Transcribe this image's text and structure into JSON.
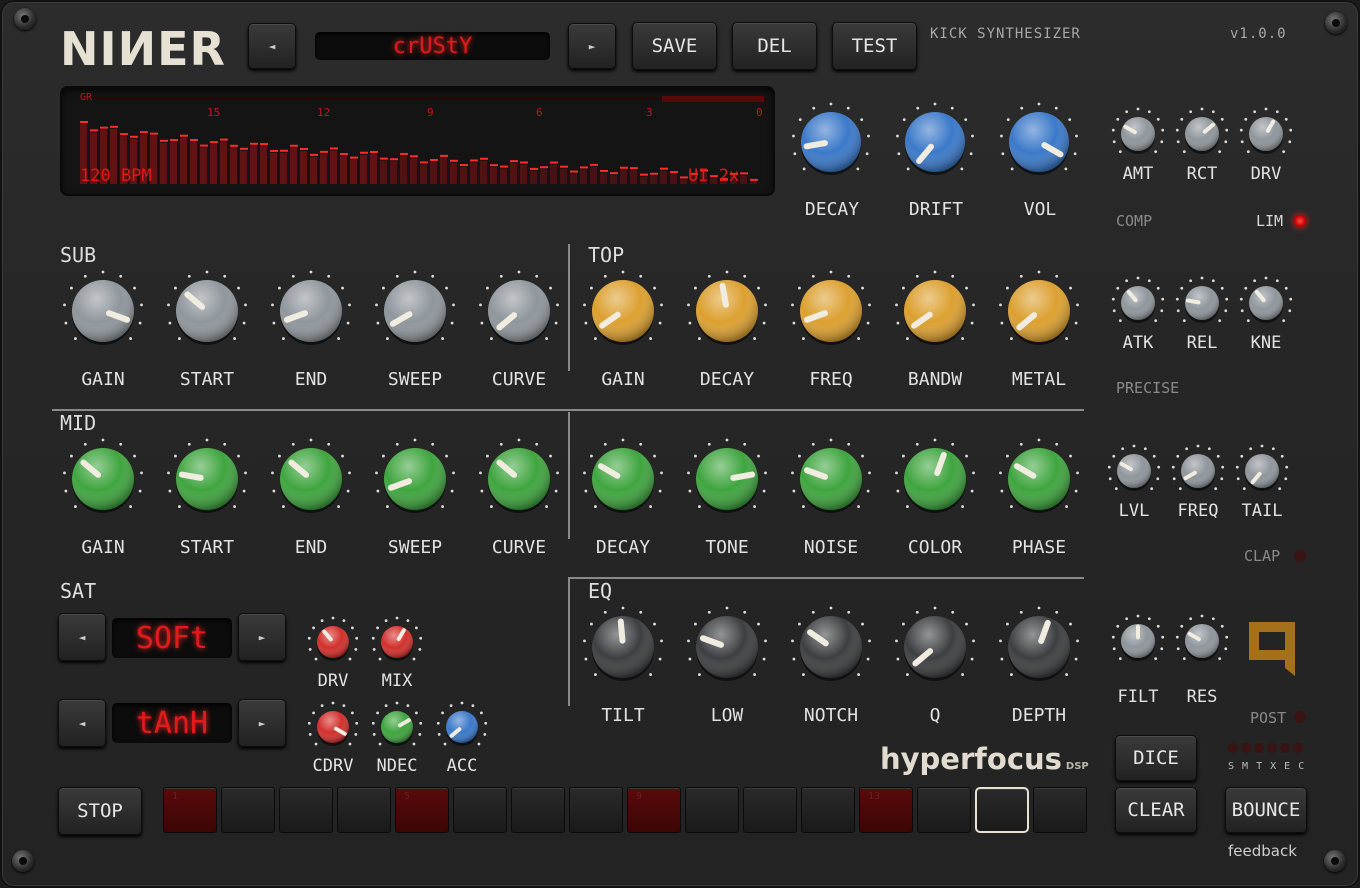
{
  "app": {
    "logo": "NIИER",
    "subtitle": "KICK SYNTHESIZER",
    "version": "v1.0.0"
  },
  "preset": {
    "name": "crUStY",
    "prev": "◄",
    "next": "►"
  },
  "toolbar": {
    "save": "SAVE",
    "del": "DEL",
    "test": "TEST"
  },
  "display": {
    "gr_label": "GR",
    "scale": [
      "15",
      "12",
      "9",
      "6",
      "3",
      "0"
    ],
    "bpm": "120 BPM",
    "ui_scale": "UI 2x"
  },
  "master": {
    "decay": "DECAY",
    "drift": "DRIFT",
    "vol": "VOL"
  },
  "sections": {
    "sub": "SUB",
    "top": "TOP",
    "mid": "MID",
    "sat": "SAT",
    "eq": "EQ"
  },
  "sub_knobs": [
    "GAIN",
    "START",
    "END",
    "SWEEP",
    "CURVE"
  ],
  "top_knobs": [
    "GAIN",
    "DECAY",
    "FREQ",
    "BANDW",
    "METAL"
  ],
  "mid_knobs": [
    "GAIN",
    "START",
    "END",
    "SWEEP",
    "CURVE"
  ],
  "noise_knobs": [
    "DECAY",
    "TONE",
    "NOISE",
    "COLOR",
    "PHASE"
  ],
  "eq_knobs": [
    "TILT",
    "LOW",
    "NOTCH",
    "Q",
    "DEPTH"
  ],
  "sat": {
    "mode1": "SOFt",
    "mode2": "tAnH",
    "drv": "DRV",
    "mix": "MIX",
    "cdrv": "CDRV",
    "ndec": "NDEC",
    "acc": "ACC"
  },
  "comp": {
    "amt": "AMT",
    "rct": "RCT",
    "drv": "DRV",
    "label": "COMP",
    "lim": "LIM",
    "atk": "ATK",
    "rel": "REL",
    "kne": "KNE",
    "precise": "PRECISE"
  },
  "clap": {
    "lvl": "LVL",
    "freq": "FREQ",
    "tail": "TAIL",
    "label": "CLAP"
  },
  "filter": {
    "filt": "FILT",
    "res": "RES",
    "post": "POST"
  },
  "transport": {
    "stop": "STOP",
    "dice": "DICE",
    "clear": "CLEAR",
    "bounce": "BOUNCE",
    "feedback": "feedback",
    "modes": "S M T X E C"
  },
  "sequencer": {
    "steps": [
      "1",
      "",
      "",
      "",
      "5",
      "",
      "",
      "",
      "9",
      "",
      "",
      "",
      "13",
      "",
      "",
      ""
    ],
    "active": [
      1,
      0,
      0,
      0,
      1,
      0,
      0,
      0,
      1,
      0,
      0,
      0,
      1,
      0,
      0,
      0
    ],
    "selected_step": 15
  },
  "brand": {
    "name": "hyperfocus",
    "suffix": "DSP"
  },
  "colors": {
    "blue": "#3b79c9",
    "gray": "#8f969c",
    "orange": "#dca030",
    "green": "#3fa53f",
    "dark": "#3d3f42",
    "red": "#d2302c",
    "led": "#e31a1a"
  }
}
